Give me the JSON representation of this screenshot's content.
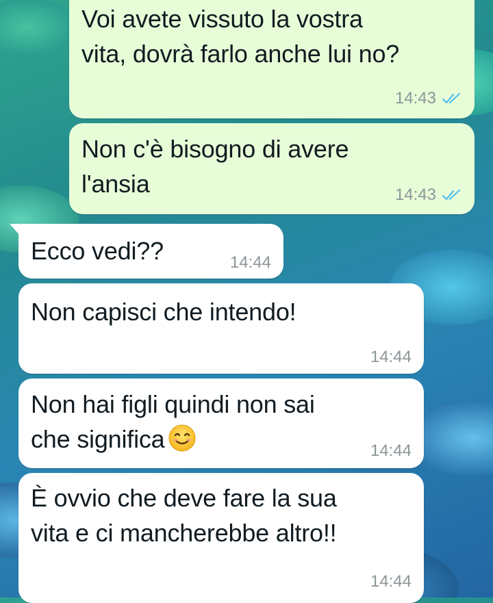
{
  "messages": [
    {
      "direction": "out",
      "text": "Voi avete vissuto la vostra\nvita, dovrà farlo anche lui no?",
      "time": "14:43",
      "status": "read-double-check-icon"
    },
    {
      "direction": "out",
      "text": "Non c'è bisogno di avere\nl'ansia",
      "time": "14:43",
      "status": "read-double-check-icon"
    },
    {
      "direction": "in",
      "text": "Ecco vedi??",
      "time": "14:44"
    },
    {
      "direction": "in",
      "text": "Non capisci che intendo!",
      "time": "14:44"
    },
    {
      "direction": "in",
      "text": "Non hai figli quindi non sai\nche significa",
      "emoji": "smiling-face-emoji-icon",
      "time": "14:44"
    },
    {
      "direction": "in",
      "text": "È ovvio che deve fare la sua\nvita e ci mancherebbe altro!!",
      "time": "14:44"
    }
  ],
  "colors": {
    "outgoing_bubble": "#e7fdd8",
    "incoming_bubble": "#ffffff",
    "read_ticks": "#53bdeb",
    "timestamp": "#8c9598"
  }
}
